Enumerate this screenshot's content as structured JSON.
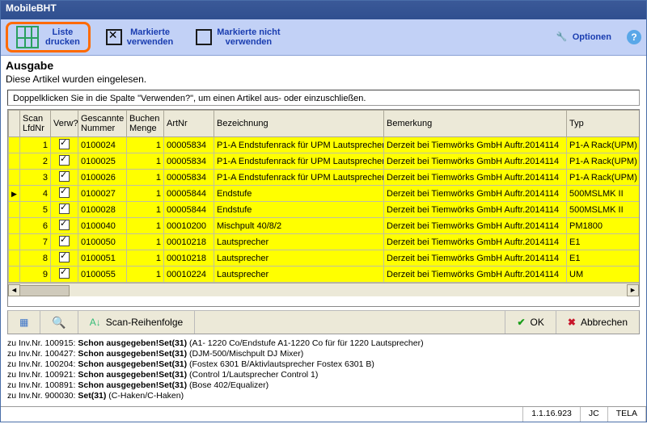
{
  "title": "MobileBHT",
  "toolbar": {
    "print": {
      "line1": "Liste",
      "line2": "drucken"
    },
    "use": {
      "line1": "Markierte",
      "line2": "verwenden"
    },
    "skip": {
      "line1": "Markierte nicht",
      "line2": "verwenden"
    },
    "options": "Optionen",
    "help": "?"
  },
  "section": {
    "heading": "Ausgabe",
    "desc": "Diese Artikel wurden eingelesen.",
    "hint": "Doppelklicken Sie in die Spalte \"Verwenden?\", um einen Artikel aus- oder einzuschließen."
  },
  "columns": {
    "scan": "Scan LfdNr",
    "verw": "Verw?",
    "gesc": "Gescannte Nummer",
    "buch": "Buchen Menge",
    "artnr": "ArtNr",
    "bez": "Bezeichnung",
    "bem": "Bemerkung",
    "typ": "Typ"
  },
  "rows": [
    {
      "i": false,
      "scan": "1",
      "v": true,
      "g": "0100024",
      "b": "1",
      "a": "00005834",
      "bez": "P1-A Endstufenrack für UPM Lautsprecher",
      "bem": "Derzeit bei Tiemwörks GmbH Auftr.2014114",
      "typ": "P1-A Rack(UPM)"
    },
    {
      "i": false,
      "scan": "2",
      "v": true,
      "g": "0100025",
      "b": "1",
      "a": "00005834",
      "bez": "P1-A Endstufenrack für UPM Lautsprecher",
      "bem": "Derzeit bei Tiemwörks GmbH Auftr.2014114",
      "typ": "P1-A Rack(UPM)"
    },
    {
      "i": false,
      "scan": "3",
      "v": true,
      "g": "0100026",
      "b": "1",
      "a": "00005834",
      "bez": "P1-A Endstufenrack für UPM Lautsprecher",
      "bem": "Derzeit bei Tiemwörks GmbH Auftr.2014114",
      "typ": "P1-A Rack(UPM)"
    },
    {
      "i": true,
      "scan": "4",
      "v": true,
      "g": "0100027",
      "b": "1",
      "a": "00005844",
      "bez": "Endstufe",
      "bem": "Derzeit bei Tiemwörks GmbH Auftr.2014114",
      "typ": "500MSLMK II"
    },
    {
      "i": false,
      "scan": "5",
      "v": true,
      "g": "0100028",
      "b": "1",
      "a": "00005844",
      "bez": "Endstufe",
      "bem": "Derzeit bei Tiemwörks GmbH Auftr.2014114",
      "typ": "500MSLMK II"
    },
    {
      "i": false,
      "scan": "6",
      "v": true,
      "g": "0100040",
      "b": "1",
      "a": "00010200",
      "bez": "Mischpult 40/8/2",
      "bem": "Derzeit bei Tiemwörks GmbH Auftr.2014114",
      "typ": "PM1800"
    },
    {
      "i": false,
      "scan": "7",
      "v": true,
      "g": "0100050",
      "b": "1",
      "a": "00010218",
      "bez": "Lautsprecher",
      "bem": "Derzeit bei Tiemwörks GmbH Auftr.2014114",
      "typ": "E1"
    },
    {
      "i": false,
      "scan": "8",
      "v": true,
      "g": "0100051",
      "b": "1",
      "a": "00010218",
      "bez": "Lautsprecher",
      "bem": "Derzeit bei Tiemwörks GmbH Auftr.2014114",
      "typ": "E1"
    },
    {
      "i": false,
      "scan": "9",
      "v": true,
      "g": "0100055",
      "b": "1",
      "a": "00010224",
      "bez": "Lautsprecher",
      "bem": "Derzeit bei Tiemwörks GmbH Auftr.2014114",
      "typ": "UM"
    }
  ],
  "actions": {
    "scan_order": "Scan-Reihenfolge",
    "ok": "OK",
    "cancel": "Abbrechen"
  },
  "log": [
    {
      "p": "zu Inv.Nr. 100915: ",
      "b": "Schon ausgegeben!Set(31)",
      "t": " (A1- 1220 Co/Endstufe A1-1220 Co für für 1220 Lautsprecher)"
    },
    {
      "p": "zu Inv.Nr. 100427: ",
      "b": "Schon ausgegeben!Set(31)",
      "t": " (DJM-500/Mischpult DJ Mixer)"
    },
    {
      "p": "zu Inv.Nr. 100204: ",
      "b": "Schon ausgegeben!Set(31)",
      "t": " (Fostex 6301 B/Aktivlautsprecher Fostex 6301 B)"
    },
    {
      "p": "zu Inv.Nr. 100921: ",
      "b": "Schon ausgegeben!Set(31)",
      "t": " (Control 1/Lautsprecher Control 1)"
    },
    {
      "p": "zu Inv.Nr. 100891: ",
      "b": "Schon ausgegeben!Set(31)",
      "t": " (Bose 402/Equalizer)"
    },
    {
      "p": "zu Inv.Nr. 900030: ",
      "b": "Set(31)",
      "t": " (C-Haken/C-Haken)"
    }
  ],
  "status": {
    "version": "1.1.16.923",
    "user": "JC",
    "db": "TELA"
  }
}
